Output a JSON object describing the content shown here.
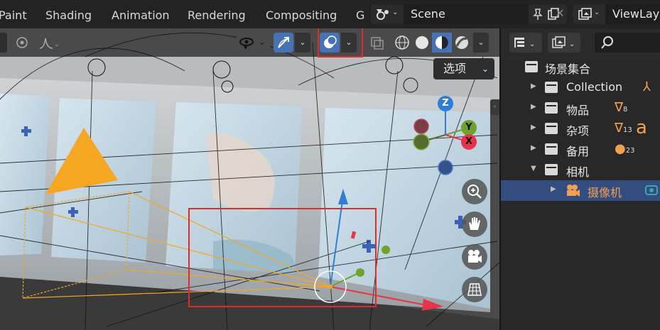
{
  "workspace_tabs": [
    "Paint",
    "Shading",
    "Animation",
    "Rendering",
    "Compositing",
    "G"
  ],
  "scene": {
    "icon": "scene-icon",
    "value": "Scene"
  },
  "view_layer": {
    "icon": "view-layer-icon",
    "value": "ViewLay"
  },
  "viewport": {
    "options_label": "选项",
    "gizmo": {
      "z": "Z",
      "y": "Y",
      "x": "X"
    }
  },
  "outliner": {
    "rows": [
      {
        "label": "场景集合",
        "indent": 0
      },
      {
        "label": "Collection",
        "indent": 1
      },
      {
        "label": "物品",
        "indent": 1,
        "count": "8"
      },
      {
        "label": "杂项",
        "indent": 1,
        "count": "13"
      },
      {
        "label": "备用",
        "indent": 1,
        "count": "23"
      },
      {
        "label": "相机",
        "indent": 1
      },
      {
        "label": "摄像机",
        "indent": 2
      }
    ]
  },
  "colors": {
    "accent_blue": "#4772b3",
    "selection_row": "#334d80",
    "camera_orange": "#f5a623",
    "highlight_red": "#e02b2b",
    "axis_x": "#e8334a",
    "axis_y": "#6ea22a",
    "axis_z": "#2e7ed8"
  }
}
